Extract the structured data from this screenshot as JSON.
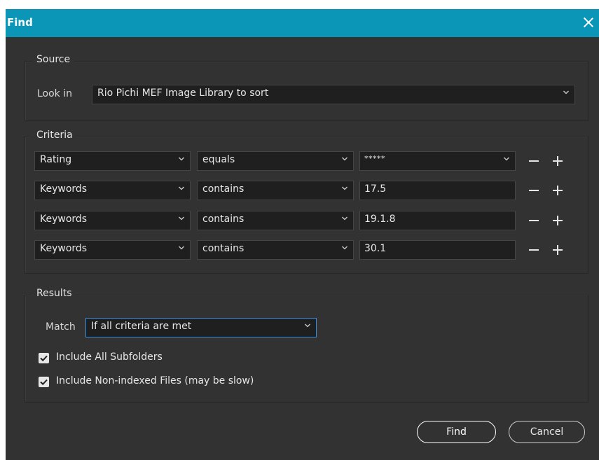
{
  "window": {
    "title": "Find"
  },
  "source": {
    "group_label": "Source",
    "look_in_label": "Look in",
    "look_in_value": "Rio Pichi MEF Image Library to sort"
  },
  "criteria": {
    "group_label": "Criteria",
    "rows": [
      {
        "field": "Rating",
        "operator": "equals",
        "value": "*****",
        "value_type": "dropdown"
      },
      {
        "field": "Keywords",
        "operator": "contains",
        "value": "17.5",
        "value_type": "text"
      },
      {
        "field": "Keywords",
        "operator": "contains",
        "value": "19.1.8",
        "value_type": "text"
      },
      {
        "field": "Keywords",
        "operator": "contains",
        "value": "30.1",
        "value_type": "text"
      }
    ]
  },
  "results": {
    "group_label": "Results",
    "match_label": "Match",
    "match_value": "If all criteria are met",
    "options": [
      {
        "label": "Include All Subfolders",
        "checked": true
      },
      {
        "label": "Include Non-indexed Files (may be slow)",
        "checked": true
      }
    ]
  },
  "buttons": {
    "find": "Find",
    "cancel": "Cancel"
  },
  "icons": {
    "close": "close-icon",
    "chevron": "chevron-down-icon",
    "remove": "minus-icon",
    "add": "plus-icon",
    "check": "checkmark-icon"
  },
  "colors": {
    "titlebar": "#0b96b7",
    "dialog_bg": "#323232",
    "field_bg": "#1f1f1f",
    "focus": "#3a8dde"
  }
}
